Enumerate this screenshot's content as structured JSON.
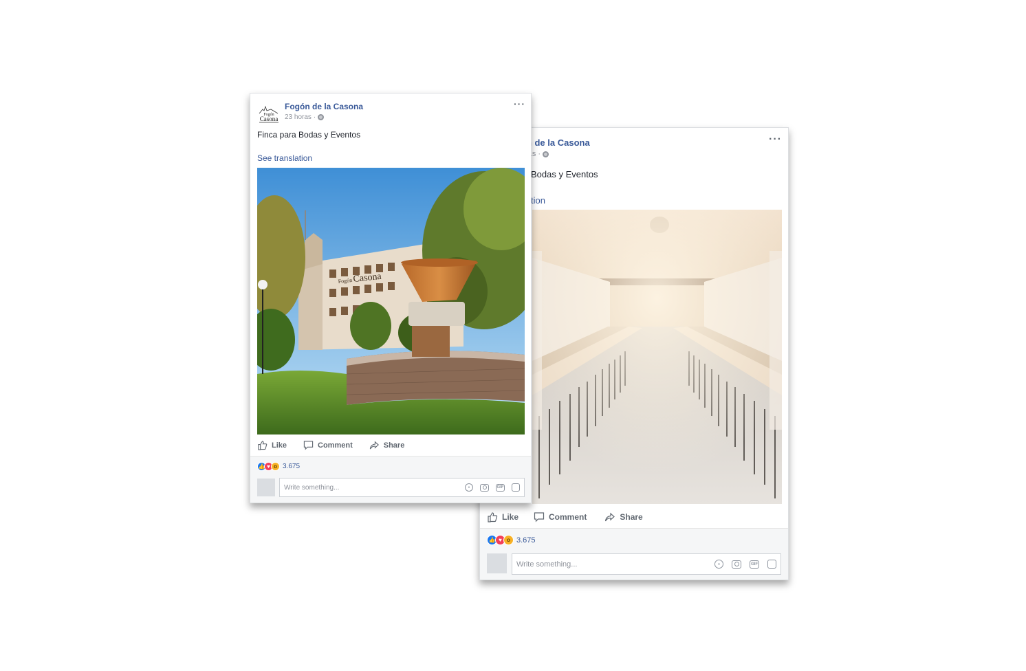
{
  "posts": [
    {
      "page_name": "Fogón de la Casona",
      "page_name_partial": "ón de la Casona",
      "time": "23 horas",
      "time_partial": "oras",
      "dot": "·",
      "text": "Finca para Bodas y Eventos",
      "text_partial": "Bodas y Eventos",
      "see_translation": "See translation",
      "see_translation_partial": "tion",
      "actions": {
        "like": "Like",
        "comment": "Comment",
        "share": "Share"
      },
      "reactions_count": "3.675",
      "composer_placeholder": "Write something...",
      "more": "···",
      "photo": "banquet hall with long dining tables under a lit canopy ceiling"
    },
    {
      "page_name": "Fogón de la Casona",
      "time": "23 horas",
      "dot": "·",
      "text": "Finca para Bodas y Eventos",
      "see_translation": "See translation",
      "actions": {
        "like": "Like",
        "comment": "Comment",
        "share": "Share"
      },
      "reactions_count": "3.675",
      "composer_placeholder": "Write something...",
      "more": "···",
      "logo_text": {
        "line1": "Fogón",
        "line2": "Casona"
      },
      "photo_sign": {
        "small": "Fogón",
        "big": "Casona"
      },
      "photo": "building exterior with large fountain and lawn"
    }
  ],
  "icons": [
    "like-icon",
    "comment-icon",
    "share-icon",
    "emoji-icon",
    "camera-icon",
    "gif-icon",
    "sticker-icon",
    "globe-icon"
  ],
  "colors": {
    "link": "#385898",
    "like": "#1877f2",
    "love": "#f33e58",
    "wow": "#f7b125"
  }
}
